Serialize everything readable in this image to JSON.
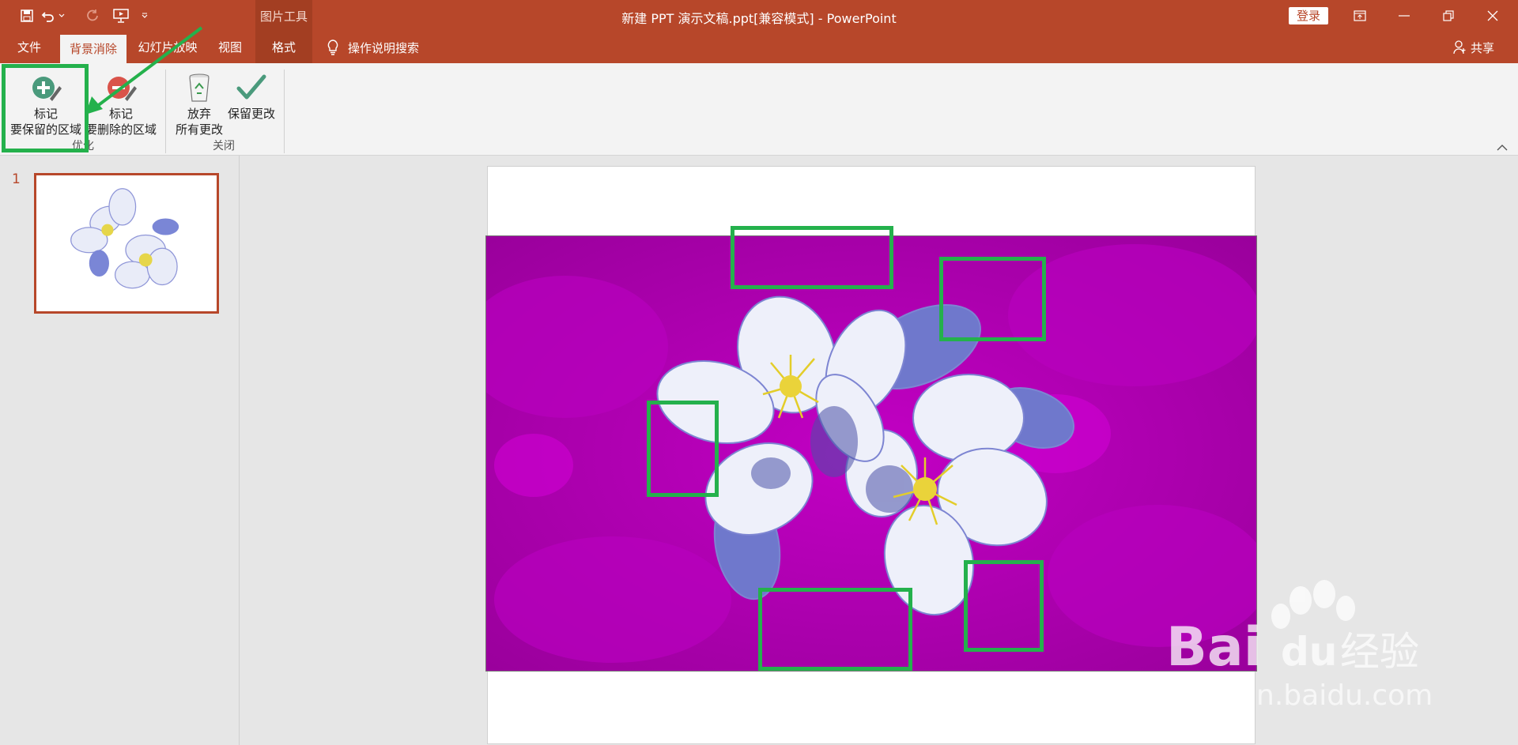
{
  "title_bar": {
    "context_group": "图片工具",
    "document_title": "新建 PPT 演示文稿.ppt[兼容模式]  -  PowerPoint",
    "login_label": "登录"
  },
  "tabs": [
    {
      "label": "文件"
    },
    {
      "label": "背景消除",
      "active": true
    },
    {
      "label": "幻灯片放映"
    },
    {
      "label": "视图"
    },
    {
      "label": "格式"
    }
  ],
  "tell_me": "操作说明搜索",
  "share_label": "共享",
  "ribbon": {
    "mark_keep": {
      "line1": "标记",
      "line2": "要保留的区域"
    },
    "mark_remove": {
      "line1": "标记",
      "line2": "要删除的区域"
    },
    "discard": {
      "line1": "放弃",
      "line2": "所有更改"
    },
    "keep_changes": {
      "line1": "保留更改"
    },
    "group_refine": "优化",
    "group_close": "关闭"
  },
  "thumbnails": [
    {
      "number": "1"
    }
  ],
  "colors": {
    "accent": "#b7472a",
    "removal_overlay": "#b000b8",
    "annotation": "#24b14c"
  },
  "watermark": {
    "brand": "Bai",
    "brand_suffix": "du",
    "cn": "经验",
    "url": "jingyan.baidu.com"
  }
}
